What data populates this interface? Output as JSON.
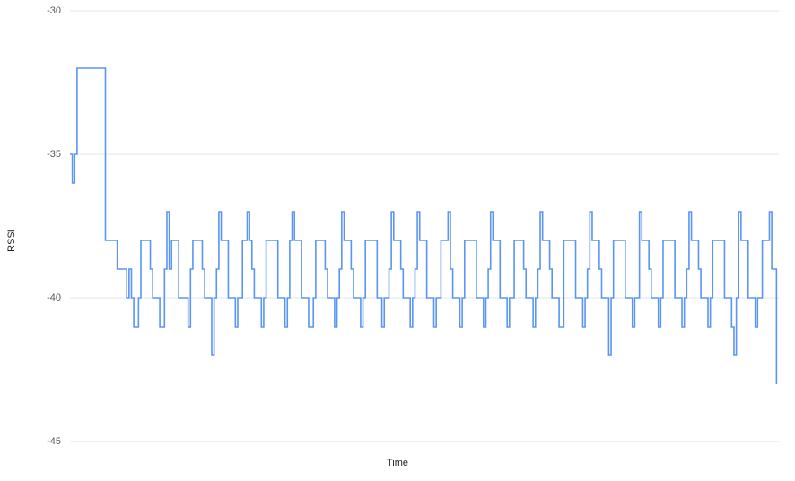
{
  "chart_data": {
    "type": "line",
    "title": "",
    "xlabel": "Time",
    "ylabel": "RSSI",
    "ylim": [
      -45,
      -30
    ],
    "xlim": [
      0,
      300
    ],
    "yticks": [
      -30,
      -35,
      -40,
      -45
    ],
    "grid": true,
    "line_color": "#5a95f5",
    "series": [
      {
        "name": "RSSI",
        "x": [
          0,
          1,
          2,
          3,
          4,
          5,
          6,
          7,
          8,
          9,
          10,
          11,
          12,
          13,
          14,
          15,
          16,
          17,
          18,
          19,
          20,
          21,
          22,
          23,
          24,
          25,
          26,
          27,
          28,
          29,
          30,
          31,
          32,
          33,
          34,
          35,
          36,
          37,
          38,
          39,
          40,
          41,
          42,
          43,
          44,
          45,
          46,
          47,
          48,
          49,
          50,
          51,
          52,
          53,
          54,
          55,
          56,
          57,
          58,
          59,
          60,
          61,
          62,
          63,
          64,
          65,
          66,
          67,
          68,
          69,
          70,
          71,
          72,
          73,
          74,
          75,
          76,
          77,
          78,
          79,
          80,
          81,
          82,
          83,
          84,
          85,
          86,
          87,
          88,
          89,
          90,
          91,
          92,
          93,
          94,
          95,
          96,
          97,
          98,
          99,
          100,
          101,
          102,
          103,
          104,
          105,
          106,
          107,
          108,
          109,
          110,
          111,
          112,
          113,
          114,
          115,
          116,
          117,
          118,
          119,
          120,
          121,
          122,
          123,
          124,
          125,
          126,
          127,
          128,
          129,
          130,
          131,
          132,
          133,
          134,
          135,
          136,
          137,
          138,
          139,
          140,
          141,
          142,
          143,
          144,
          145,
          146,
          147,
          148,
          149,
          150,
          151,
          152,
          153,
          154,
          155,
          156,
          157,
          158,
          159,
          160,
          161,
          162,
          163,
          164,
          165,
          166,
          167,
          168,
          169,
          170,
          171,
          172,
          173,
          174,
          175,
          176,
          177,
          178,
          179,
          180,
          181,
          182,
          183,
          184,
          185,
          186,
          187,
          188,
          189,
          190,
          191,
          192,
          193,
          194,
          195,
          196,
          197,
          198,
          199,
          200,
          201,
          202,
          203,
          204,
          205,
          206,
          207,
          208,
          209,
          210,
          211,
          212,
          213,
          214,
          215,
          216,
          217,
          218,
          219,
          220,
          221,
          222,
          223,
          224,
          225,
          226,
          227,
          228,
          229,
          230,
          231,
          232,
          233,
          234,
          235,
          236,
          237,
          238,
          239,
          240,
          241,
          242,
          243,
          244,
          245,
          246,
          247,
          248,
          249,
          250,
          251,
          252,
          253,
          254,
          255,
          256,
          257,
          258,
          259,
          260,
          261,
          262,
          263,
          264,
          265,
          266,
          267,
          268,
          269,
          270,
          271,
          272,
          273,
          274,
          275,
          276,
          277,
          278,
          279,
          280,
          281,
          282,
          283,
          284,
          285,
          286,
          287,
          288,
          289,
          290,
          291,
          292,
          293,
          294,
          295,
          296,
          297,
          298,
          299
        ],
        "values": [
          -35,
          -36,
          -35,
          -32,
          -32,
          -32,
          -32,
          -32,
          -32,
          -32,
          -32,
          -32,
          -32,
          -32,
          -32,
          -38,
          -38,
          -38,
          -38,
          -38,
          -39,
          -39,
          -39,
          -39,
          -40,
          -39,
          -40,
          -41,
          -41,
          -40,
          -38,
          -38,
          -38,
          -38,
          -39,
          -40,
          -40,
          -40,
          -41,
          -41,
          -39,
          -37,
          -39,
          -38,
          -38,
          -38,
          -40,
          -40,
          -40,
          -40,
          -41,
          -39,
          -38,
          -38,
          -38,
          -38,
          -39,
          -40,
          -40,
          -40,
          -42,
          -40,
          -39,
          -37,
          -38,
          -38,
          -38,
          -40,
          -40,
          -40,
          -41,
          -40,
          -40,
          -38,
          -38,
          -37,
          -38,
          -39,
          -40,
          -40,
          -40,
          -41,
          -40,
          -38,
          -38,
          -38,
          -38,
          -38,
          -40,
          -40,
          -40,
          -41,
          -40,
          -38,
          -37,
          -38,
          -38,
          -38,
          -40,
          -40,
          -40,
          -41,
          -41,
          -40,
          -38,
          -38,
          -38,
          -38,
          -39,
          -40,
          -40,
          -40,
          -41,
          -40,
          -39,
          -37,
          -38,
          -38,
          -38,
          -39,
          -40,
          -40,
          -40,
          -41,
          -40,
          -38,
          -38,
          -38,
          -38,
          -38,
          -40,
          -40,
          -41,
          -40,
          -40,
          -39,
          -37,
          -38,
          -38,
          -38,
          -39,
          -40,
          -40,
          -40,
          -41,
          -40,
          -39,
          -37,
          -38,
          -38,
          -38,
          -40,
          -40,
          -40,
          -41,
          -40,
          -40,
          -38,
          -38,
          -38,
          -37,
          -39,
          -40,
          -40,
          -40,
          -41,
          -40,
          -38,
          -38,
          -38,
          -38,
          -38,
          -40,
          -40,
          -40,
          -41,
          -40,
          -39,
          -37,
          -38,
          -38,
          -38,
          -40,
          -40,
          -40,
          -41,
          -40,
          -40,
          -38,
          -38,
          -38,
          -38,
          -39,
          -40,
          -40,
          -40,
          -41,
          -40,
          -39,
          -37,
          -38,
          -38,
          -38,
          -39,
          -40,
          -40,
          -40,
          -41,
          -41,
          -38,
          -38,
          -38,
          -38,
          -38,
          -40,
          -40,
          -40,
          -41,
          -40,
          -39,
          -37,
          -38,
          -38,
          -38,
          -39,
          -40,
          -40,
          -40,
          -42,
          -40,
          -38,
          -38,
          -38,
          -38,
          -38,
          -40,
          -40,
          -40,
          -41,
          -40,
          -40,
          -37,
          -38,
          -38,
          -38,
          -39,
          -40,
          -40,
          -40,
          -41,
          -40,
          -38,
          -38,
          -38,
          -38,
          -38,
          -40,
          -40,
          -40,
          -41,
          -40,
          -39,
          -37,
          -38,
          -38,
          -38,
          -39,
          -40,
          -40,
          -40,
          -41,
          -40,
          -38,
          -38,
          -38,
          -38,
          -38,
          -40,
          -40,
          -40,
          -41,
          -42,
          -40,
          -37,
          -38,
          -38,
          -38,
          -40,
          -40,
          -40,
          -41,
          -40,
          -40,
          -38,
          -38,
          -38,
          -37,
          -39,
          -39,
          -43
        ]
      }
    ]
  }
}
